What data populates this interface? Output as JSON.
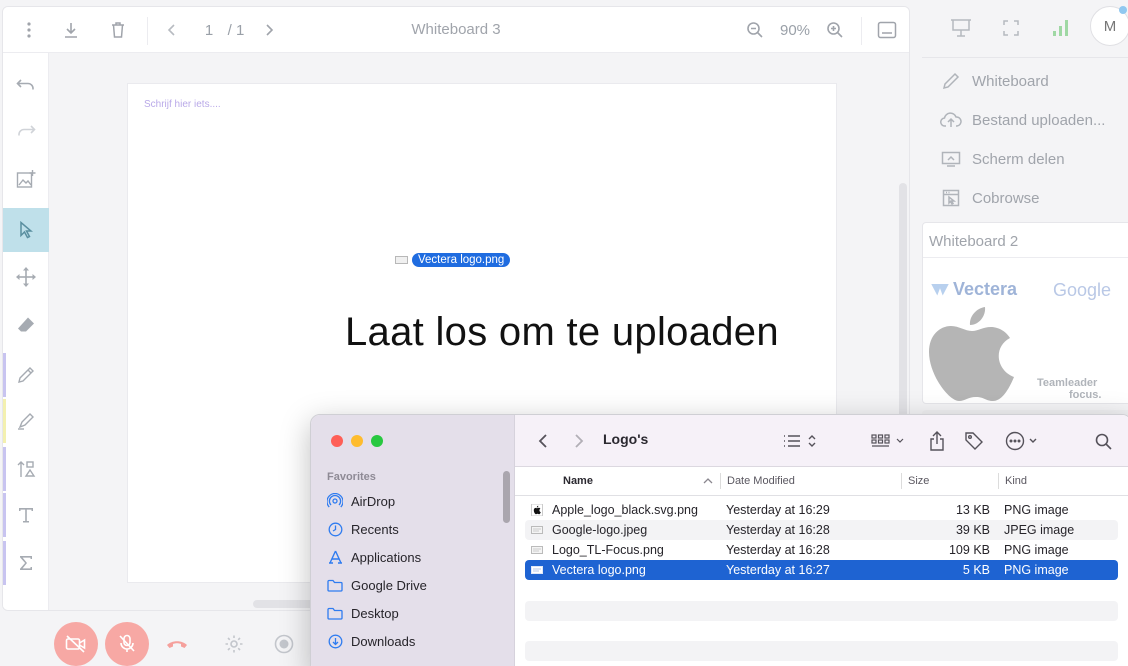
{
  "whiteboard": {
    "title": "Whiteboard 3",
    "page_current": "1",
    "page_total": "/ 1",
    "zoom": "90%",
    "placeholder": "Schrijf hier iets....",
    "drop_text": "Laat los om te uploaden",
    "drag_file": "Vectera logo.png"
  },
  "right_menu": {
    "items": [
      {
        "label": "Whiteboard",
        "icon": "pencil-icon"
      },
      {
        "label": "Bestand uploaden...",
        "icon": "cloud-upload-icon"
      },
      {
        "label": "Scherm delen",
        "icon": "screen-share-icon"
      },
      {
        "label": "Cobrowse",
        "icon": "cobrowse-icon"
      }
    ],
    "avatar_initial": "M",
    "thumbnail_title": "Whiteboard 2",
    "thumbnail_logos": {
      "vectera": "Vectera",
      "google": "Google",
      "teamleader": "Teamleader",
      "teamleader_sub": "focus."
    }
  },
  "finder": {
    "folder": "Logo's",
    "favorites_label": "Favorites",
    "sidebar": [
      {
        "label": "AirDrop",
        "icon": "airdrop-icon"
      },
      {
        "label": "Recents",
        "icon": "clock-icon"
      },
      {
        "label": "Applications",
        "icon": "applications-icon"
      },
      {
        "label": "Google Drive",
        "icon": "folder-icon"
      },
      {
        "label": "Desktop",
        "icon": "folder-icon"
      },
      {
        "label": "Downloads",
        "icon": "download-icon"
      }
    ],
    "columns": {
      "name": "Name",
      "date": "Date Modified",
      "size": "Size",
      "kind": "Kind"
    },
    "files": [
      {
        "name": "Apple_logo_black.svg.png",
        "date": "Yesterday at 16:29",
        "size": "13 KB",
        "kind": "PNG image",
        "selected": false
      },
      {
        "name": "Google-logo.jpeg",
        "date": "Yesterday at 16:28",
        "size": "39 KB",
        "kind": "JPEG image",
        "selected": false
      },
      {
        "name": "Logo_TL-Focus.png",
        "date": "Yesterday at 16:28",
        "size": "109 KB",
        "kind": "PNG image",
        "selected": false
      },
      {
        "name": "Vectera logo.png",
        "date": "Yesterday at 16:27",
        "size": "5 KB",
        "kind": "PNG image",
        "selected": true
      }
    ]
  },
  "colors": {
    "accent_blue": "#1e63d2",
    "active_tool": "#bfe0ea",
    "call_red": "#f7a8a4"
  }
}
